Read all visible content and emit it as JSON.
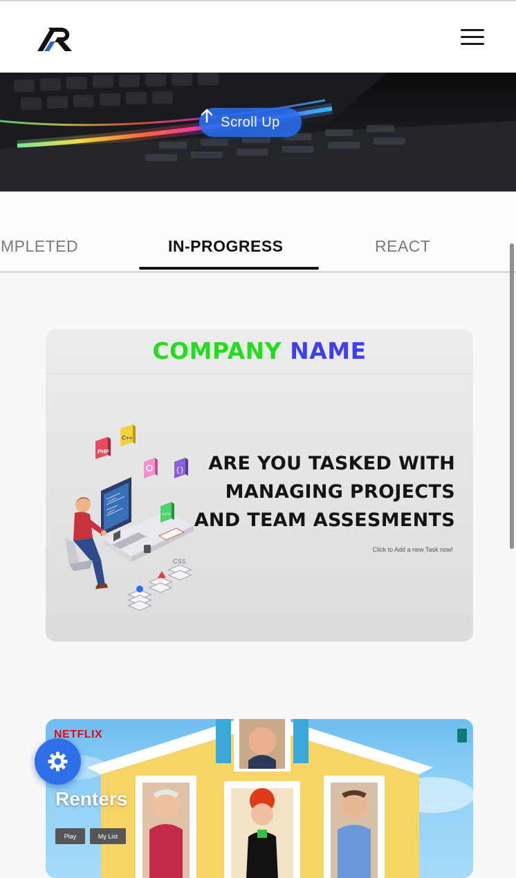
{
  "navbar": {
    "logo_alt": "R logo",
    "menu_icon": "hamburger-menu-icon"
  },
  "hero": {
    "scroll_up_label": "Scroll Up",
    "scroll_up_icon": "arrow-up-icon"
  },
  "tabs": {
    "items": [
      {
        "label": "MPLETED",
        "active": false
      },
      {
        "label": "IN-PROGRESS",
        "active": true
      },
      {
        "label": "REACT",
        "active": false
      }
    ]
  },
  "projects": [
    {
      "brand_part1": "COMPANY",
      "brand_part2": "NAME",
      "headline_lines": [
        "ARE YOU TASKED WITH",
        "MANAGING PROJECTS",
        "AND TEAM ASSESMENTS"
      ],
      "cta": "Click to Add a new Task now!",
      "illustration_badges": [
        "PHP",
        "C++",
        "CSS"
      ]
    },
    {
      "brand": "NETFLIX",
      "title": "Renters",
      "play_label": "Play",
      "mylist_label": "My List"
    }
  ],
  "fab": {
    "icon": "settings-icon"
  },
  "colors": {
    "accent_blue": "#2f6fe9",
    "company_green": "#22dd1c",
    "company_blue": "#3d3ff0",
    "netflix_red": "#e50914"
  }
}
